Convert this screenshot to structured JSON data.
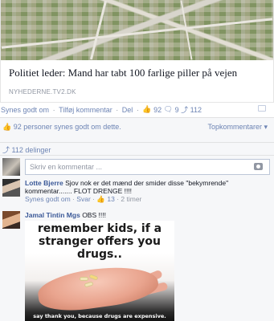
{
  "link_card": {
    "title": "Politiet leder: Mand har tabt 100 farlige piller på vejen",
    "domain": "NYHEDERNE.TV2.DK"
  },
  "actions": {
    "like": "Synes godt om",
    "comment": "Tilføj kommentar",
    "share": "Del",
    "likes_count": "92",
    "comments_count": "9",
    "shares_count": "112"
  },
  "ufi": {
    "likes_text": "92 personer synes godt om dette.",
    "top_comments": "Topkommentarer",
    "shares_text": "112 delinger",
    "comment_placeholder": "Skriv en kommentar ..."
  },
  "comments": [
    {
      "author": "Lotte Bjerre",
      "text": "Sjov nok er det mænd der smider disse \"bekymrende\" kommentar....... FLOT DRENGE !!!!",
      "like": "Synes godt om",
      "reply": "Svar",
      "likes": "13",
      "time": "2 timer"
    },
    {
      "author": "Jamal Tintin Mgs",
      "text": "OBS !!!!",
      "image_top": "remember kids, if a stranger offers you drugs..",
      "image_bottom": "say thank you, because drugs are expensive."
    }
  ],
  "colors": {
    "link": "#3b5998",
    "action": "#6d84b4",
    "muted": "#9197a3",
    "ufi_bg": "#f6f7f9"
  }
}
